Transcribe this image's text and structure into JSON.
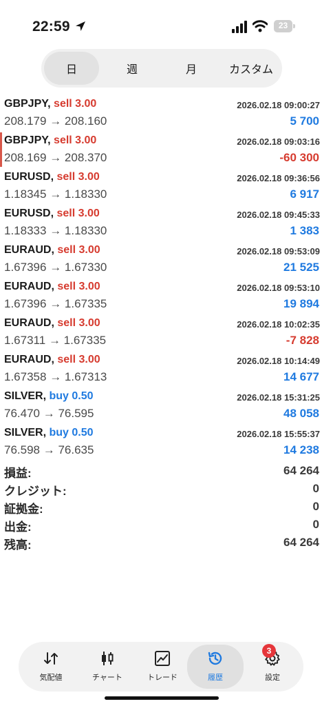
{
  "status_bar": {
    "time": "22:59",
    "battery": "23"
  },
  "period_tabs": [
    {
      "label": "日",
      "active": true
    },
    {
      "label": "週",
      "active": false
    },
    {
      "label": "月",
      "active": false
    },
    {
      "label": "カスタム",
      "active": false
    }
  ],
  "deals": [
    {
      "symbol": "GBPJPY,",
      "side": "sell 3.00",
      "time": "2026.02.18 09:00:27",
      "open": "208.179",
      "arrow": "→",
      "close": "208.160",
      "profit": "5 700"
    },
    {
      "symbol": "GBPJPY,",
      "side": "sell 3.00",
      "time": "2026.02.18 09:03:16",
      "open": "208.169",
      "arrow": "→",
      "close": "208.370",
      "profit": "-60 300"
    },
    {
      "symbol": "EURUSD,",
      "side": "sell 3.00",
      "time": "2026.02.18 09:36:56",
      "open": "1.18345",
      "arrow": "→",
      "close": "1.18330",
      "profit": "6 917"
    },
    {
      "symbol": "EURUSD,",
      "side": "sell 3.00",
      "time": "2026.02.18 09:45:33",
      "open": "1.18333",
      "arrow": "→",
      "close": "1.18330",
      "profit": "1 383"
    },
    {
      "symbol": "EURAUD,",
      "side": "sell 3.00",
      "time": "2026.02.18 09:53:09",
      "open": "1.67396",
      "arrow": "→",
      "close": "1.67330",
      "profit": "21 525"
    },
    {
      "symbol": "EURAUD,",
      "side": "sell 3.00",
      "time": "2026.02.18 09:53:10",
      "open": "1.67396",
      "arrow": "→",
      "close": "1.67335",
      "profit": "19 894"
    },
    {
      "symbol": "EURAUD,",
      "side": "sell 3.00",
      "time": "2026.02.18 10:02:35",
      "open": "1.67311",
      "arrow": "→",
      "close": "1.67335",
      "profit": "-7 828"
    },
    {
      "symbol": "EURAUD,",
      "side": "sell 3.00",
      "time": "2026.02.18 10:14:49",
      "open": "1.67358",
      "arrow": "→",
      "close": "1.67313",
      "profit": "14 677"
    },
    {
      "symbol": "SILVER,",
      "side": "buy 0.50",
      "time": "2026.02.18 15:31:25",
      "open": "76.470",
      "arrow": "→",
      "close": "76.595",
      "profit": "48 058"
    },
    {
      "symbol": "SILVER,",
      "side": "buy 0.50",
      "time": "2026.02.18 15:55:37",
      "open": "76.598",
      "arrow": "→",
      "close": "76.635",
      "profit": "14 238"
    }
  ],
  "summary": [
    {
      "label": "損益:",
      "value": "64 264"
    },
    {
      "label": "クレジット:",
      "value": "0"
    },
    {
      "label": "証拠金:",
      "value": "0"
    },
    {
      "label": "出金:",
      "value": "0"
    },
    {
      "label": "残高:",
      "value": "64 264"
    }
  ],
  "tabbar": [
    {
      "label": "気配値",
      "icon": "quotes-arrows-icon"
    },
    {
      "label": "チャート",
      "icon": "candlestick-chart-icon"
    },
    {
      "label": "トレード",
      "icon": "trade-line-chart-icon"
    },
    {
      "label": "履歴",
      "icon": "history-clock-icon",
      "active": true
    },
    {
      "label": "設定",
      "icon": "settings-gear-icon",
      "badge": "3"
    }
  ],
  "colors": {
    "sell": "#d63b2f",
    "buy": "#1f7ae0",
    "profit_positive": "#1f7ae0",
    "profit_negative": "#d63b2f",
    "badge": "#e5363a"
  }
}
